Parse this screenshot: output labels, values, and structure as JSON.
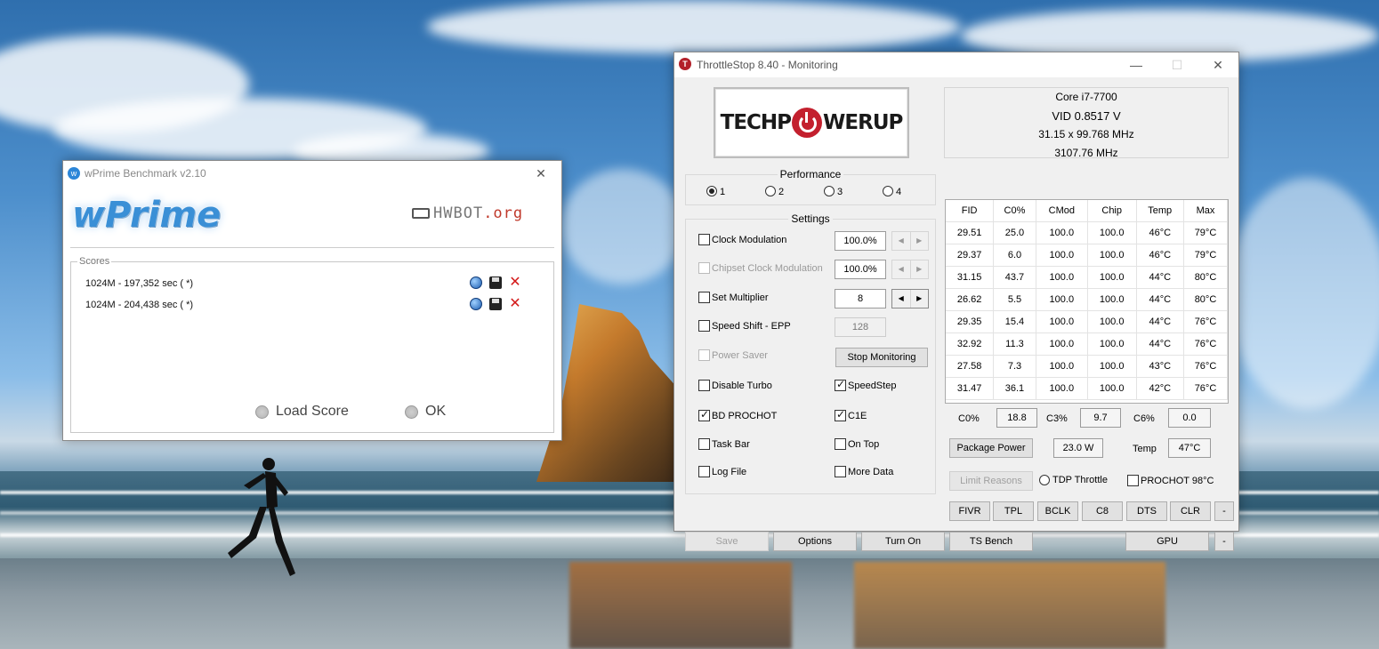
{
  "wprime": {
    "title": "wPrime Benchmark v2.10",
    "logo_text": "wPrime",
    "hwbot_text_main": "HWBOT",
    "hwbot_text_suffix": ".org",
    "scores_legend": "Scores",
    "scores": [
      {
        "text": "1024M - 197,352 sec (  *)"
      },
      {
        "text": "1024M - 204,438 sec (  *)"
      }
    ],
    "load_score_label": "Load Score",
    "ok_label": "OK"
  },
  "throttlestop": {
    "title": "ThrottleStop 8.40 - Monitoring",
    "logo": {
      "part1": "TECHP",
      "part2": "WERUP"
    },
    "cpu": {
      "name": "Core i7-7700",
      "vid": "VID  0.8517 V",
      "multiplier": "31.15 x 99.768 MHz",
      "speed": "3107.76 MHz"
    },
    "performance": {
      "title": "Performance",
      "options": [
        "1",
        "2",
        "3",
        "4"
      ],
      "selected": "1"
    },
    "settings": {
      "title": "Settings",
      "clock_modulation": {
        "label": "Clock Modulation",
        "value": "100.0%",
        "checked": false
      },
      "chipset_clock_modulation": {
        "label": "Chipset Clock Modulation",
        "value": "100.0%",
        "checked": false,
        "disabled": true
      },
      "set_multiplier": {
        "label": "Set Multiplier",
        "value": "8",
        "checked": false
      },
      "speed_shift": {
        "label": "Speed Shift - EPP",
        "value": "128",
        "checked": false
      },
      "power_saver": {
        "label": "Power Saver",
        "checked": false,
        "disabled": true
      },
      "stop_monitoring": "Stop Monitoring",
      "disable_turbo": {
        "label": "Disable Turbo",
        "checked": false
      },
      "speedstep": {
        "label": "SpeedStep",
        "checked": true
      },
      "bd_prochot": {
        "label": "BD PROCHOT",
        "checked": true
      },
      "c1e": {
        "label": "C1E",
        "checked": true
      },
      "task_bar": {
        "label": "Task Bar",
        "checked": false
      },
      "on_top": {
        "label": "On Top",
        "checked": false
      },
      "log_file": {
        "label": "Log File",
        "checked": false
      },
      "more_data": {
        "label": "More Data",
        "checked": false
      }
    },
    "table": {
      "headers": [
        "FID",
        "C0%",
        "CMod",
        "Chip",
        "Temp",
        "Max"
      ],
      "rows": [
        [
          "29.51",
          "25.0",
          "100.0",
          "100.0",
          "46°C",
          "79°C"
        ],
        [
          "29.37",
          "6.0",
          "100.0",
          "100.0",
          "46°C",
          "79°C"
        ],
        [
          "31.15",
          "43.7",
          "100.0",
          "100.0",
          "44°C",
          "80°C"
        ],
        [
          "26.62",
          "5.5",
          "100.0",
          "100.0",
          "44°C",
          "80°C"
        ],
        [
          "29.35",
          "15.4",
          "100.0",
          "100.0",
          "44°C",
          "76°C"
        ],
        [
          "32.92",
          "11.3",
          "100.0",
          "100.0",
          "44°C",
          "76°C"
        ],
        [
          "27.58",
          "7.3",
          "100.0",
          "100.0",
          "43°C",
          "76°C"
        ],
        [
          "31.47",
          "36.1",
          "100.0",
          "100.0",
          "42°C",
          "76°C"
        ]
      ]
    },
    "cstates": {
      "c0_label": "C0%",
      "c0": "18.8",
      "c3_label": "C3%",
      "c3": "9.7",
      "c6_label": "C6%",
      "c6": "0.0"
    },
    "package_power_label": "Package Power",
    "package_power": "23.0 W",
    "temp_label": "Temp",
    "temp": "47°C",
    "limit_reasons_label": "Limit Reasons",
    "tdp_throttle_label": "TDP Throttle",
    "prochot_label": "PROCHOT 98°C",
    "tool_buttons": [
      "FIVR",
      "TPL",
      "BCLK",
      "C8",
      "DTS",
      "CLR"
    ],
    "minus_label": "-",
    "bottom_buttons": {
      "save": "Save",
      "options": "Options",
      "turn_on": "Turn On",
      "ts_bench": "TS Bench",
      "gpu": "GPU"
    }
  }
}
